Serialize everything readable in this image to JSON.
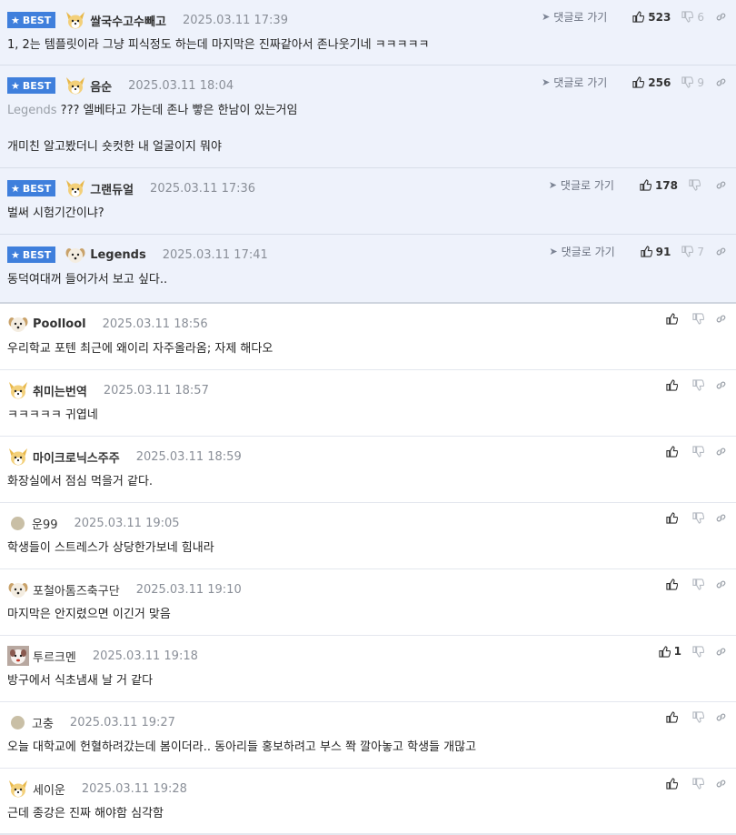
{
  "labels": {
    "best": "BEST",
    "reply_to": "댓글로 가기"
  },
  "colors": {
    "best_badge": "#3f7fdc",
    "best_background": "#eef2fb"
  },
  "best_comments": [
    {
      "nick": "쌀국수고수빼고",
      "date": "2025.03.11 17:39",
      "text": "1, 2는 템플릿이라 그냥 피식정도 하는데 마지막은 진짜같아서 존나웃기네 ㅋㅋㅋㅋㅋ",
      "ref": "",
      "up": "523",
      "down": "6",
      "avatar": "dog-yellow"
    },
    {
      "nick": "음순",
      "date": "2025.03.11 18:04",
      "ref": "Legends",
      "text": "??? 엘베타고 가는데 존나 빻은 한남이 있는거임\n\n개미친 알고봤더니 숏컷한 내 얼굴이지 뭐야",
      "up": "256",
      "down": "9",
      "avatar": "dog-yellow"
    },
    {
      "nick": "그랜듀얼",
      "date": "2025.03.11 17:36",
      "text": "벌써 시험기간이냐?",
      "ref": "",
      "up": "178",
      "down": "",
      "avatar": "dog-yellow"
    },
    {
      "nick": "Legends",
      "date": "2025.03.11 17:41",
      "text": "동덕여대꺼 들어가서 보고 싶다..",
      "ref": "",
      "up": "91",
      "down": "7",
      "avatar": "dog-white"
    }
  ],
  "comments": [
    {
      "nick": "Poollool",
      "date": "2025.03.11 18:56",
      "text": "우리학교 포텐 최근에 왜이리 자주올라옴; 자제 해다오",
      "up": "",
      "avatar": "dog-white"
    },
    {
      "nick": "취미는번역",
      "date": "2025.03.11 18:57",
      "text": "ㅋㅋㅋㅋㅋ 귀엽네",
      "up": "",
      "avatar": "dog-yellow"
    },
    {
      "nick": "마이크로닉스주주",
      "date": "2025.03.11 18:59",
      "text": "화장실에서 점심 먹을거 같다.",
      "up": "",
      "avatar": "dog-yellow"
    },
    {
      "nick": "운99",
      "date": "2025.03.11 19:05",
      "text": "학생들이 스트레스가 상당한가보네 힘내라",
      "up": "",
      "avatar": "dot"
    },
    {
      "nick": "포철아톰즈축구단",
      "date": "2025.03.11 19:10",
      "text": "마지막은 안지렸으면 이긴거 맞음",
      "up": "",
      "avatar": "dog-white"
    },
    {
      "nick": "투르크멘",
      "date": "2025.03.11 19:18",
      "text": "방구에서 식초냄새 날 거 같다",
      "up": "1",
      "avatar": "dog-photo"
    },
    {
      "nick": "고충",
      "date": "2025.03.11 19:27",
      "text": "오늘 대학교에 헌혈하려갔는데 봄이더라.. 동아리들 홍보하려고 부스 쫙 깔아놓고 학생들 개많고",
      "up": "",
      "avatar": "dot"
    },
    {
      "nick": "세이운",
      "date": "2025.03.11 19:28",
      "text": "근데 종강은 진짜 해야함 심각함",
      "up": "",
      "avatar": "dog-yellow"
    }
  ]
}
